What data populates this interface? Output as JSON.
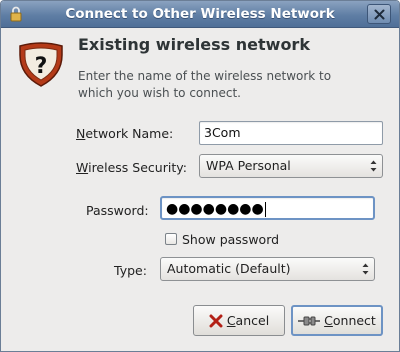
{
  "window": {
    "title": "Connect to Other Wireless Network",
    "lock_icon": "lock-icon",
    "close_icon": "close-icon"
  },
  "dialog": {
    "icon": "question-shield-icon",
    "heading": "Existing wireless network",
    "description": "Enter the name of the wireless network to which you wish to connect."
  },
  "form": {
    "network_name": {
      "mnemonic": "N",
      "label_rest": "etwork Name:",
      "value": "3Com"
    },
    "wireless_security": {
      "mnemonic": "W",
      "label_rest": "ireless Security:",
      "selected": "WPA Personal"
    },
    "password": {
      "label": "Password:",
      "masked_value": "●●●●●●●●"
    },
    "show_password": {
      "label": "Show password",
      "checked": false
    },
    "type": {
      "label": "Type:",
      "selected": "Automatic (Default)"
    }
  },
  "buttons": {
    "cancel": {
      "mnemonic": "C",
      "label_rest": "ancel",
      "icon": "cancel-x-icon"
    },
    "connect": {
      "mnemonic": "C",
      "label_rest": "onnect",
      "icon": "connect-plug-icon"
    }
  }
}
